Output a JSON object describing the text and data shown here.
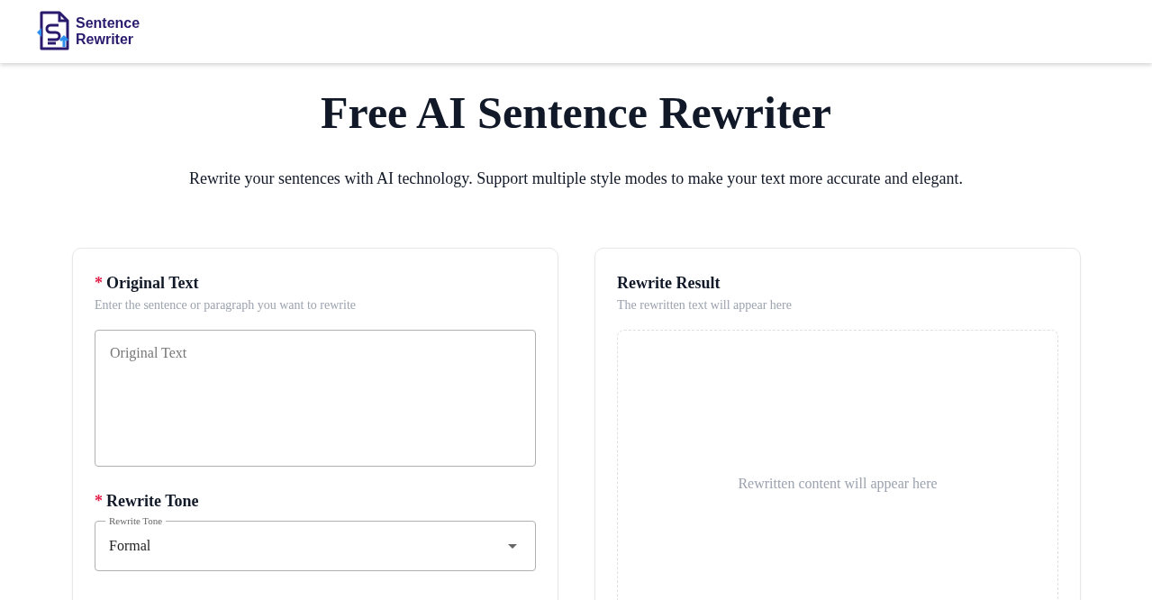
{
  "header": {
    "logo_text": [
      "Sentence",
      "Rewriter"
    ]
  },
  "hero": {
    "title": "Free AI Sentence Rewriter",
    "subtitle": "Rewrite your sentences with AI technology. Support multiple style modes to make your text more accurate and elegant."
  },
  "input_card": {
    "fields": [
      {
        "kind": "textarea",
        "label": "Original Text",
        "required_mark": "*",
        "hint": "Enter the sentence or paragraph you want to rewrite",
        "placeholder": "Original Text"
      },
      {
        "kind": "select",
        "label": "Rewrite Tone",
        "required_mark": "*",
        "floating_label": "Rewrite Tone",
        "value": "Formal"
      }
    ]
  },
  "result_card": {
    "title": "Rewrite Result",
    "hint": "The rewritten text will appear here",
    "empty_text": "Rewritten content will appear here"
  }
}
